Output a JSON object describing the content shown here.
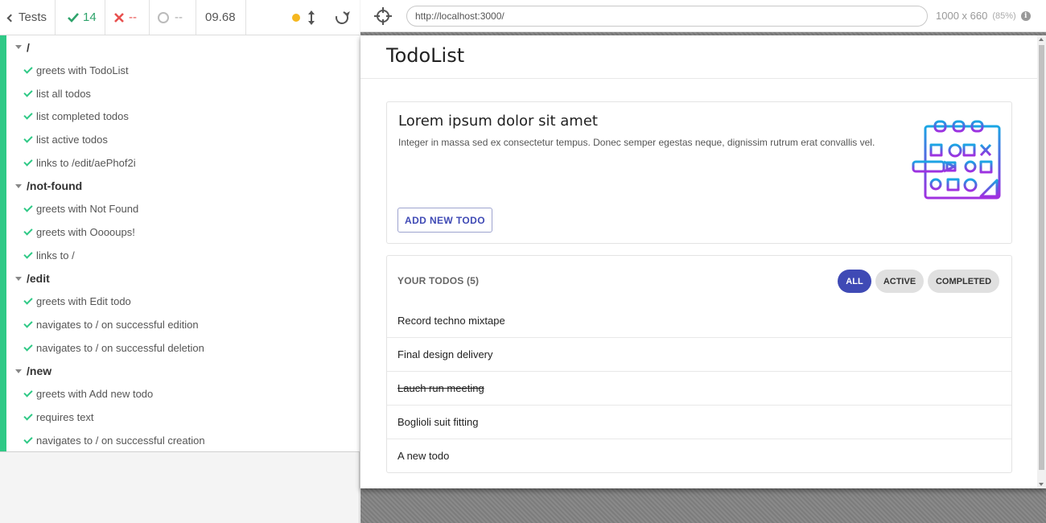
{
  "runner": {
    "tests_label": "Tests",
    "passed": "14",
    "failed": "--",
    "pending": "--",
    "duration": "09.68",
    "status_color": "#f5b71f"
  },
  "suites": [
    {
      "title": "/",
      "tests": [
        "greets with TodoList",
        "list all todos",
        "list completed todos",
        "list active todos",
        "links to /edit/aePhof2i"
      ]
    },
    {
      "title": "/not-found",
      "tests": [
        "greets with Not Found",
        "greets with Ooooups!",
        "links to /"
      ]
    },
    {
      "title": "/edit",
      "tests": [
        "greets with Edit todo",
        "navigates to / on successful edition",
        "navigates to / on successful deletion"
      ]
    },
    {
      "title": "/new",
      "tests": [
        "greets with Add new todo",
        "requires text",
        "navigates to / on successful creation"
      ]
    }
  ],
  "browser": {
    "url": "http://localhost:3000/",
    "viewport": "1000 x 660",
    "scale": "(85%)"
  },
  "app": {
    "title": "TodoList",
    "hero_title": "Lorem ipsum dolor sit amet",
    "hero_text": "Integer in massa sed ex consectetur tempus. Donec semper egestas neque, dignissim rutrum erat convallis vel.",
    "add_button": "ADD NEW TODO",
    "todos_heading": "YOUR TODOS (5)",
    "filters": {
      "all": "ALL",
      "active": "ACTIVE",
      "completed": "COMPLETED",
      "selected": "all"
    },
    "todos": [
      {
        "text": "Record techno mixtape",
        "completed": false
      },
      {
        "text": "Final design delivery",
        "completed": false
      },
      {
        "text": "Lauch run meeting",
        "completed": true
      },
      {
        "text": "Boglioli suit fitting",
        "completed": false
      },
      {
        "text": "A new todo",
        "completed": false
      }
    ],
    "accent_color": "#3f4ab5"
  }
}
